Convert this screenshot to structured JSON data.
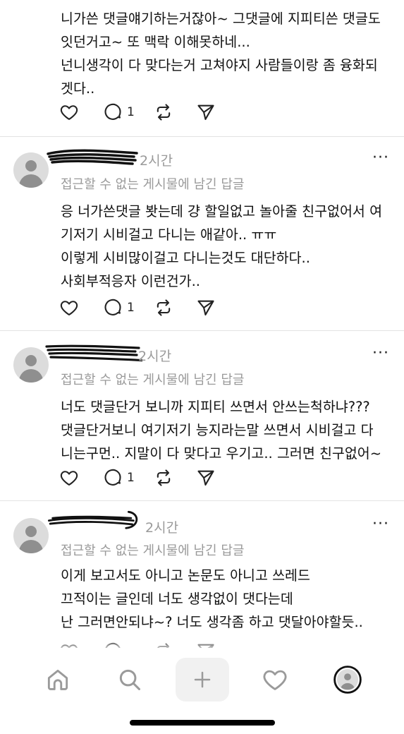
{
  "post0": {
    "lines": [
      "니가쓴 댓글얘기하는거잖아~ 그댓글에 지피티쓴 댓글도",
      "잇던거고~ 또 맥락 이해못하네...",
      "넌니생각이 다 맞다는거 고쳐야지 사람들이랑 좀 융화되",
      "겟다.."
    ],
    "reply_count": "1"
  },
  "reply_subtitle": "접근할 수 없는 게시물에 남긴 답글",
  "post1": {
    "time": "2시간",
    "lines": [
      "응 너가쓴댓글 봣는데 걍 할일없고 놀아줄 친구없어서 여",
      "기저기 시비걸고 다니는 애같아.. ㅠㅠ",
      "이렇게 시비많이걸고 다니는것도 대단하다..",
      "사회부적응자 이런건가.."
    ],
    "reply_count": "1"
  },
  "post2": {
    "time": "2시간",
    "lines": [
      "너도 댓글단거 보니까 지피티 쓰면서 안쓰는척하냐???",
      "댓글단거보니 여기저기 능지라는말 쓰면서 시비걸고 다",
      "니는구먼.. 지말이 다 맞다고 우기고.. 그러면 친구없어~"
    ],
    "reply_count": "1"
  },
  "post3": {
    "time": "2시간",
    "lines": [
      "이게 보고서도 아니고 논문도 아니고 쓰레드",
      "끄적이는 글인데 너도 생각없이 댓다는데",
      "난 그러면안되냐~? 너도 생각좀 하고 댓달아야할듯.."
    ]
  },
  "more_label": "···",
  "icons": {
    "like": "heart-icon",
    "reply": "comment-bubble-icon",
    "repost": "repost-icon",
    "share": "send-icon",
    "avatar": "default-avatar-icon",
    "tab_home": "home-icon",
    "tab_search": "search-icon",
    "tab_create": "plus-icon",
    "tab_activity": "heart-icon",
    "tab_profile": "profile-icon"
  },
  "colors": {
    "text": "#111111",
    "muted": "#9a9a9a",
    "divider": "#e3e3e3",
    "avatar_bg": "#dcdcdc"
  }
}
